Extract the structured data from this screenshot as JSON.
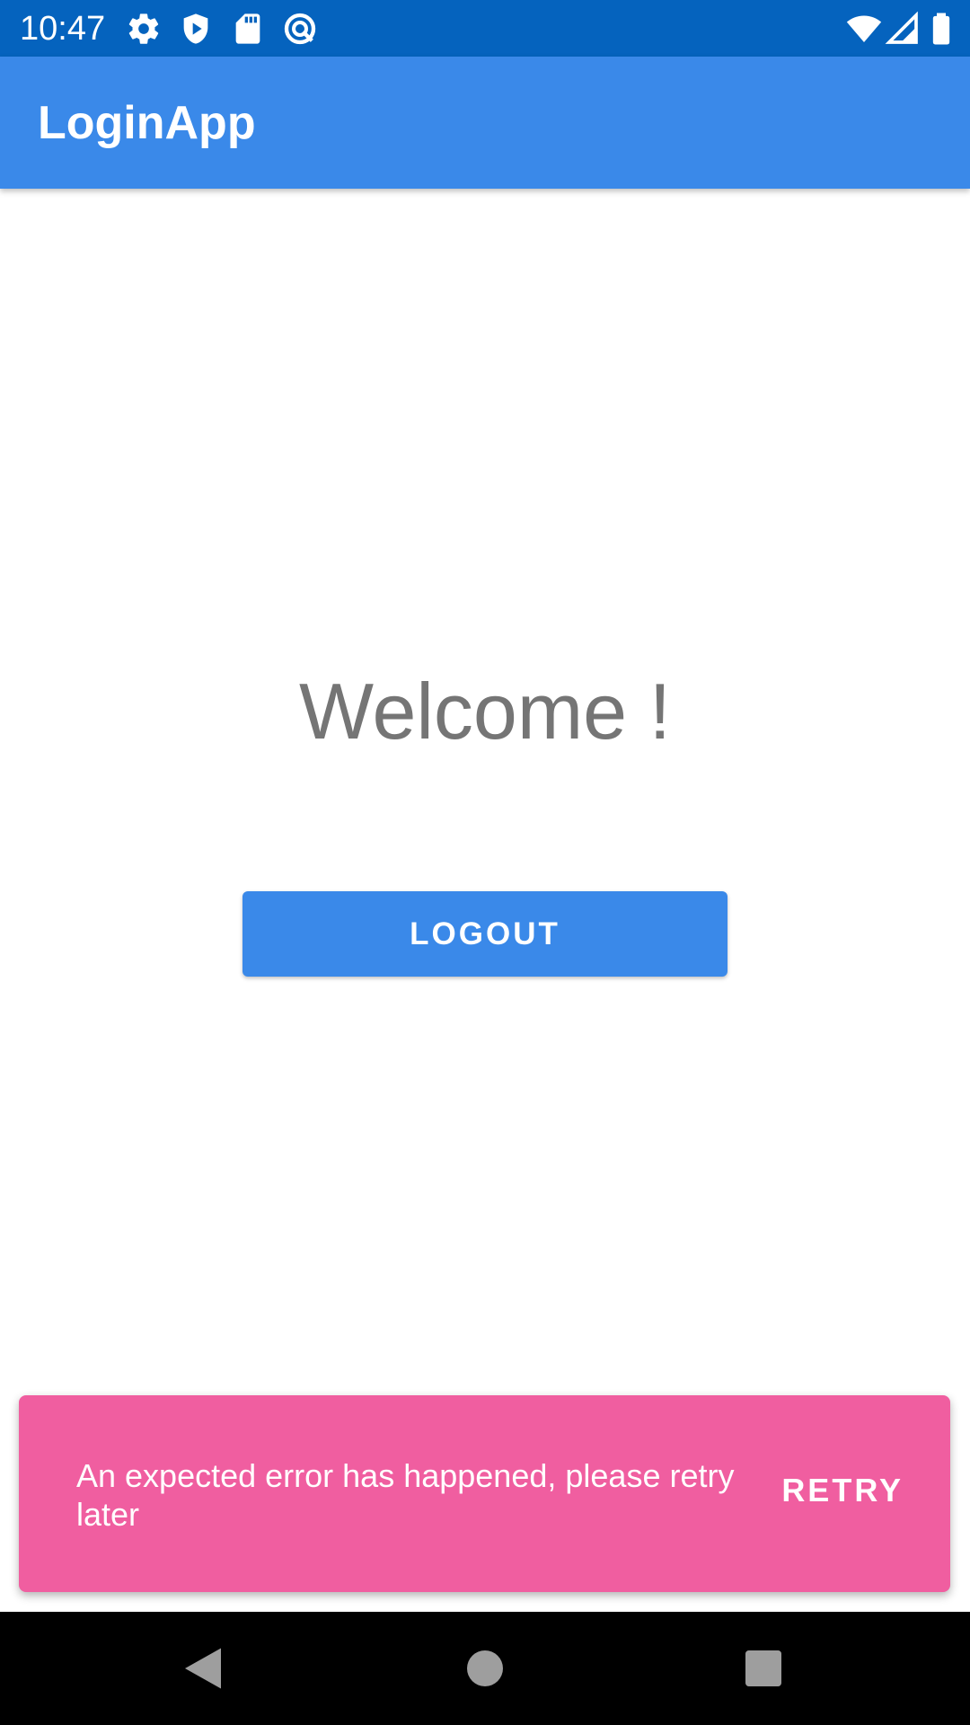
{
  "status_bar": {
    "time": "10:47",
    "left_icons": [
      "settings-icon",
      "play-protect-icon",
      "sd-card-icon",
      "data-saver-icon"
    ],
    "right_icons": [
      "wifi-icon",
      "cell-signal-icon",
      "battery-icon"
    ],
    "background_color": "#0563BE"
  },
  "app_bar": {
    "title": "LoginApp",
    "background_color": "#3A89E9"
  },
  "main": {
    "welcome_text": "Welcome !",
    "logout_label": "LOGOUT"
  },
  "snackbar": {
    "message": "An expected error has happened, please retry later",
    "action_label": "RETRY",
    "background_color": "#F05EA0"
  },
  "nav_bar": {
    "buttons": [
      "back-icon",
      "home-icon",
      "recents-icon"
    ]
  }
}
